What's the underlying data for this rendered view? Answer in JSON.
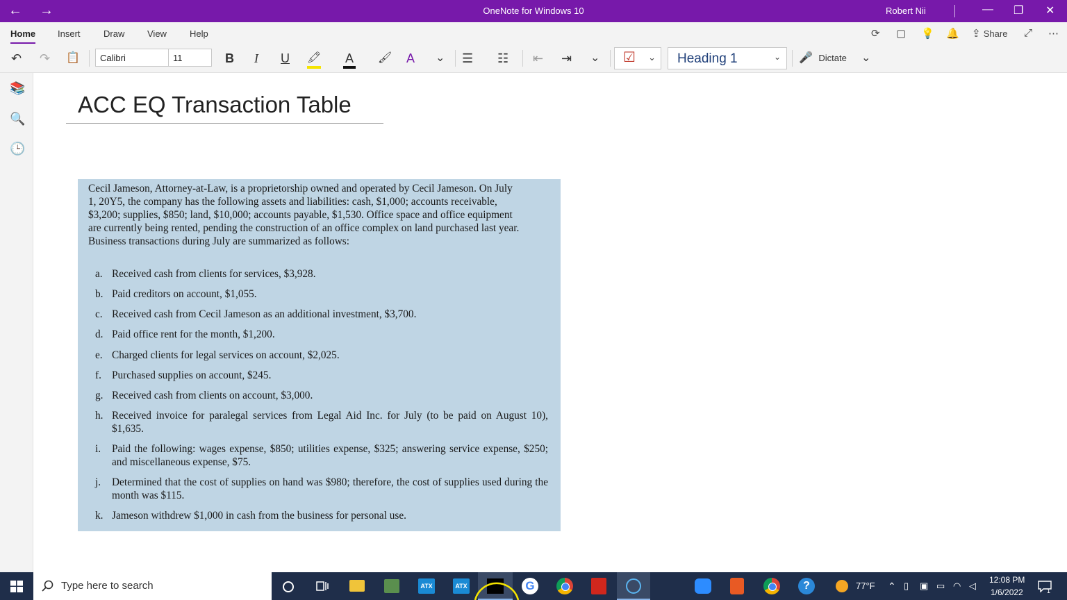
{
  "window": {
    "title": "OneNote for Windows 10",
    "user": "Robert Nii",
    "back_icon": "←",
    "forward_icon": "→",
    "minimize_icon": "—",
    "restore_icon": "❐",
    "close_icon": "✕"
  },
  "menu": {
    "tabs": [
      "Home",
      "Insert",
      "Draw",
      "View",
      "Help"
    ],
    "share_label": "Share",
    "icons": {
      "sync": "⟳",
      "pages": "▢",
      "ideas": "💡",
      "notify": "🔔",
      "share": "⇪",
      "expand": "⤢",
      "more": "⋯"
    }
  },
  "toolbar": {
    "undo": "↶",
    "redo": "↷",
    "clipboard": "📋",
    "font_name": "Calibri",
    "font_size": "11",
    "bold": "B",
    "italic": "I",
    "underline": "U",
    "highlight": "🖍",
    "font_color": "A",
    "format_painter": "🖌",
    "clear_format": "A",
    "more": "⌄",
    "bullets": "☰",
    "numbering": "☷",
    "outdent": "⇤",
    "indent": "⇥",
    "checkbox": "☑",
    "style": "Heading 1",
    "dictate": "Dictate",
    "mic": "🎤"
  },
  "sidebar": {
    "notebooks": "📚",
    "search": "🔍",
    "recent": "🕒"
  },
  "page": {
    "title": "ACC EQ Transaction Table",
    "problem": {
      "intro": "Cecil Jameson, Attorney-at-Law, is a proprietorship owned and operated by Cecil Jameson. On July 1, 20Y5, the company has the following assets and liabilities: cash, $1,000; accounts receivable, $3,200; supplies, $850; land, $10,000; accounts payable, $1,530. Office space and office equipment are currently being rented, pending the construction of an office complex on land purchased last year. Business transactions during July are summarized as follows:",
      "items": [
        {
          "letter": "a.",
          "text": "Received cash from clients for services, $3,928."
        },
        {
          "letter": "b.",
          "text": "Paid creditors on account, $1,055."
        },
        {
          "letter": "c.",
          "text": "Received cash from Cecil Jameson as an additional investment, $3,700."
        },
        {
          "letter": "d.",
          "text": "Paid office rent for the month, $1,200."
        },
        {
          "letter": "e.",
          "text": "Charged clients for legal services on account, $2,025."
        },
        {
          "letter": "f.",
          "text": "Purchased supplies on account, $245."
        },
        {
          "letter": "g.",
          "text": "Received cash from clients on account, $3,000."
        },
        {
          "letter": "h.",
          "text": "Received invoice for paralegal services from Legal Aid Inc. for July (to be paid on August 10), $1,635."
        },
        {
          "letter": "i.",
          "text": "Paid the following: wages expense, $850; utilities expense, $325; answering service expense, $250; and miscellaneous expense, $75."
        },
        {
          "letter": "j.",
          "text": "Determined that the cost of supplies on hand was $980; therefore, the cost of supplies used during the month was $115."
        },
        {
          "letter": "k.",
          "text": "Jameson withdrew $1,000 in cash from the business for personal use."
        }
      ]
    }
  },
  "taskbar": {
    "search_placeholder": "Type here to search",
    "weather": "77°F",
    "time": "12:08 PM",
    "date": "1/6/2022",
    "notifications": "1",
    "apps": [
      "cortana",
      "task-view",
      "file-explorer",
      "app",
      "atx",
      "atx",
      "active-app",
      "google",
      "chrome",
      "acrobat",
      "media",
      "zoom",
      "snip",
      "chrome",
      "help"
    ]
  },
  "colors": {
    "accent": "#7719aa",
    "image_bg": "#bfd5e4",
    "taskbar": "#1f2e4a"
  }
}
